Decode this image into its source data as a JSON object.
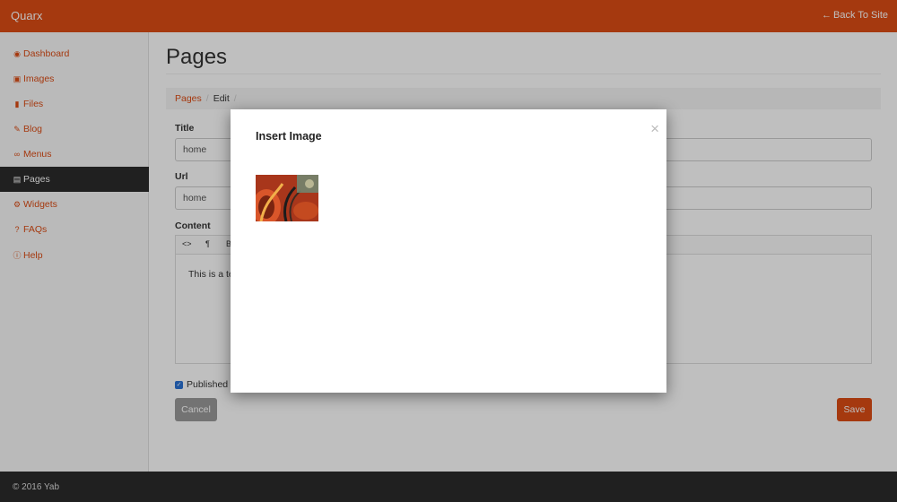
{
  "header": {
    "brand": "Quarx",
    "back_label": "Back To Site"
  },
  "sidebar": {
    "items": [
      {
        "label": "Dashboard",
        "icon": "dashboard-icon",
        "active": false
      },
      {
        "label": "Images",
        "icon": "image-icon",
        "active": false
      },
      {
        "label": "Files",
        "icon": "file-icon",
        "active": false
      },
      {
        "label": "Blog",
        "icon": "pencil-icon",
        "active": false
      },
      {
        "label": "Menus",
        "icon": "link-icon",
        "active": false
      },
      {
        "label": "Pages",
        "icon": "page-icon",
        "active": true
      },
      {
        "label": "Widgets",
        "icon": "gear-icon",
        "active": false
      },
      {
        "label": "FAQs",
        "icon": "question-icon",
        "active": false
      },
      {
        "label": "Help",
        "icon": "info-icon",
        "active": false
      }
    ]
  },
  "main": {
    "title": "Pages",
    "breadcrumb": [
      "Pages",
      "Edit"
    ],
    "form": {
      "title_label": "Title",
      "title_value": "home",
      "url_label": "Url",
      "url_value": "home",
      "content_label": "Content",
      "toolbar": [
        "<>",
        "¶",
        "B"
      ],
      "content_value": "This is a te",
      "published_label": "Published",
      "published_checked": true,
      "cancel_label": "Cancel",
      "save_label": "Save"
    }
  },
  "footer": {
    "text": "© 2016 Yab"
  },
  "modal": {
    "title": "Insert Image",
    "close_glyph": "×"
  },
  "colors": {
    "accent": "#dc4c15",
    "sidebar_active": "#2b2b2b",
    "footer": "#2b2b2b"
  }
}
